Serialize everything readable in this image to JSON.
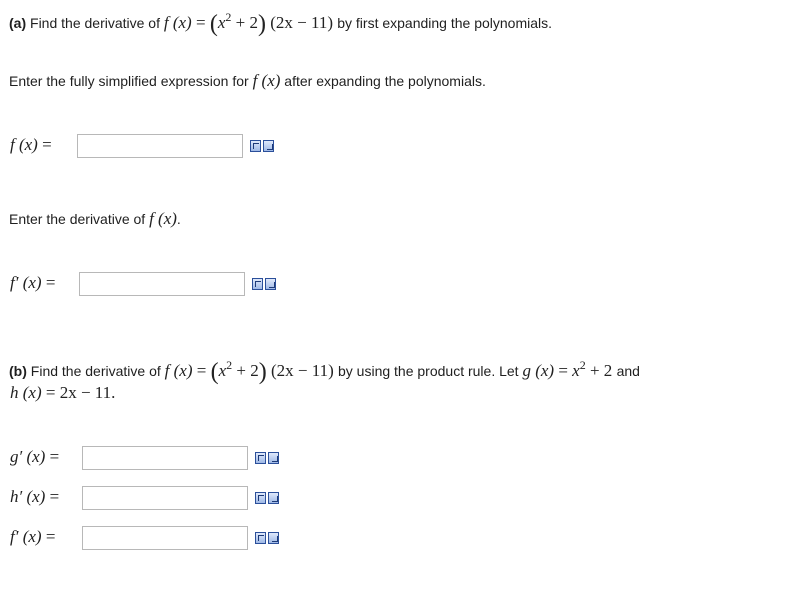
{
  "part_a": {
    "label": "(a)",
    "text_before": "Find the derivative of",
    "text_after": "by first expanding the polynomials.",
    "instruction_1": "Enter the fully simplified expression for",
    "instruction_1_after": "after expanding the polynomials.",
    "instruction_2": "Enter the derivative of",
    "instruction_2_after": ".",
    "field_f_value": "",
    "field_fprime_value": ""
  },
  "part_b": {
    "label": "(b)",
    "text_before": "Find the derivative of",
    "text_middle": "by using the product rule. Let",
    "text_and": "and",
    "field_gprime_value": "",
    "field_hprime_value": "",
    "field_fprime_value": ""
  },
  "math": {
    "f_of_x": "f (x)",
    "f_prime_of_x": "f′ (x)",
    "g_prime_of_x": "g′ (x)",
    "h_prime_of_x": "h′ (x)",
    "g_of_x": "g (x)",
    "h_of_x": "h (x)",
    "equals": "=",
    "expression_left": "x",
    "expression_exp": "2",
    "expression_plus2": "+ 2",
    "expression_right": "(2x − 11)",
    "g_def": "x",
    "g_def_exp": "2",
    "g_def_tail": "+ 2",
    "h_def": "2x − 11."
  },
  "icons": {
    "first": "equation-editor-icon",
    "second": "preview-icon"
  }
}
